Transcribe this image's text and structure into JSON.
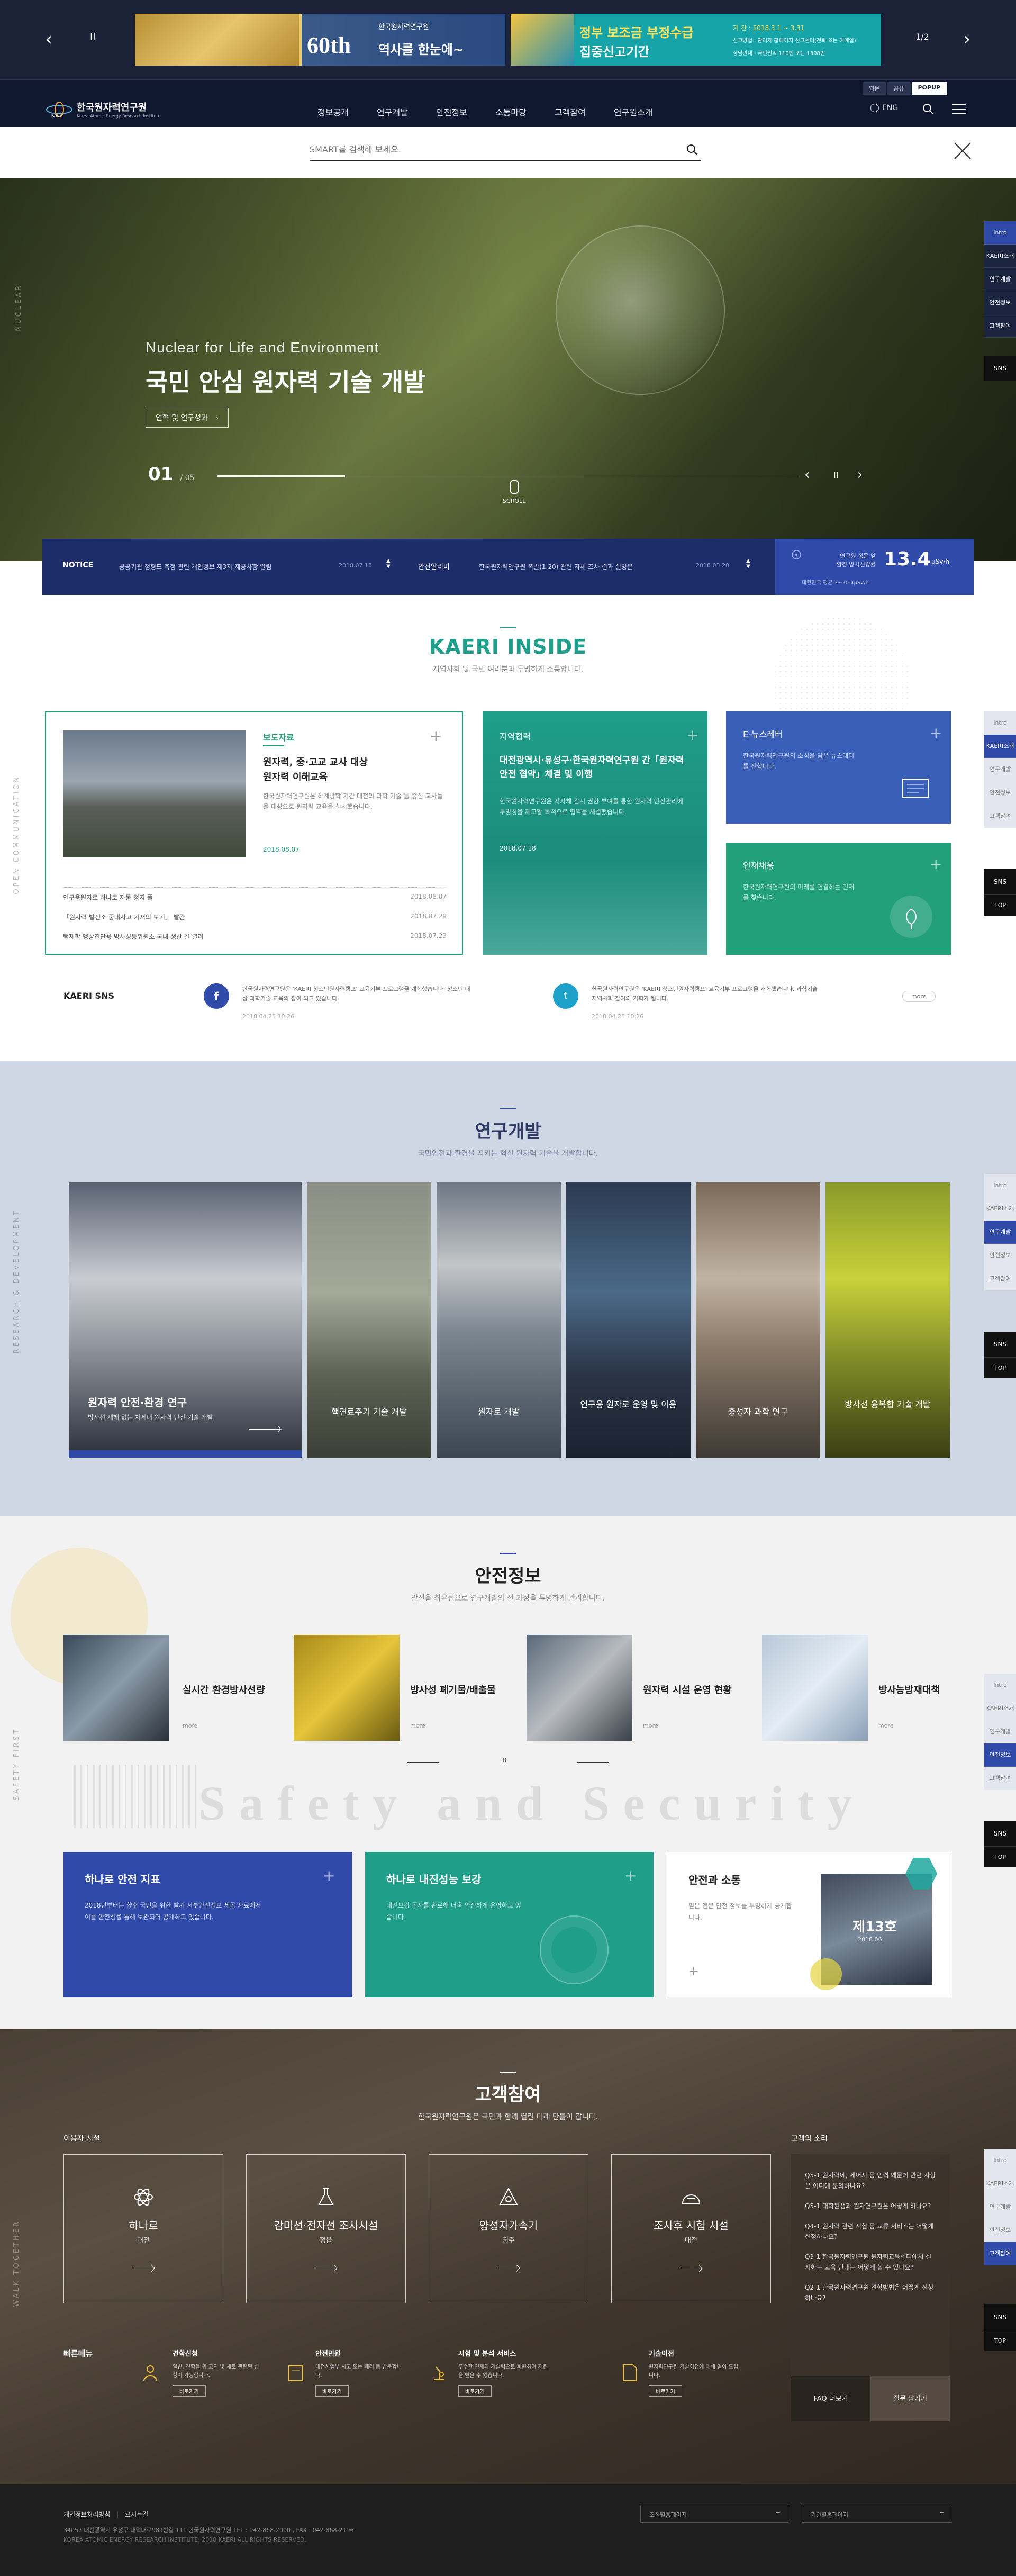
{
  "popup_banner": {
    "popup1": {
      "small": "한국원자력연구원",
      "big": "60th",
      "rest": "역사를 한눈에~"
    },
    "popup2": {
      "line1": "정부 보조금 부정수급",
      "line2": "집중신고기간",
      "detail1": "기 간 : 2018.3.1 ~ 3.31",
      "detail2": "신고방법 : 관리자 홈페이지 신고센터(전화 또는 이메일)",
      "detail3": "상담안내 : 국민권익 110번 또는 1398번"
    },
    "counter": "1/2",
    "pause": "II"
  },
  "utility": {
    "links": [
      "영문",
      "공유",
      "POPUP"
    ]
  },
  "header": {
    "logo_kr": "한국원자력연구원",
    "logo_en": "Korea Atomic Energy Research Institute",
    "logo_mark": "KAERI",
    "gnb": [
      "정보공개",
      "연구개발",
      "안전정보",
      "소통마당",
      "고객참여",
      "연구원소개"
    ],
    "lang": "ENG"
  },
  "search": {
    "placeholder": "SMART를 검색해 보세요."
  },
  "hero": {
    "subtitle": "Nuclear for Life and Environment",
    "title": "국민 안심 원자력 기술 개발",
    "button": "연혁 및 연구성과",
    "current": "01",
    "total": "05",
    "scroll": "SCROLL",
    "side_label": "NUCLEAR"
  },
  "notice": {
    "label": "NOTICE",
    "item1": "공공기관 정형도 측정 관련 개인정보 제3자 제공사항 알림",
    "date1": "2018.07.18",
    "label2": "안전알리미",
    "item2": "한국원자력연구원 폭발(1.20) 관련 자체 조사 결과 설명문",
    "date2": "2018.03.20",
    "rad_label1": "연구원 정문 앞",
    "rad_label2": "환경 방사선량률",
    "rad_value": "13.4",
    "rad_unit": "μSv/h",
    "rad_note": "대한민국 평균 3~30.4μSv/h"
  },
  "inside": {
    "title": "KAERI INSIDE",
    "subtitle": "지역사회 및 국민 여러분과 투명하게 소통합니다.",
    "press": {
      "tag": "보도자료",
      "headline1": "원자력, 중·고교 교사 대상",
      "headline2": "원자력 이해교육",
      "desc": "한국원자력연구원은 하계방학 기간 대전의 과학 기술 틀 중심 교사들을 대상으로 원자력 교육을 실시했습니다.",
      "date": "2018.08.07",
      "list": [
        {
          "title": "연구용원자로 하나로 자동 정지 풀",
          "date": "2018.08.07"
        },
        {
          "title": "「원자력 발전소 중대사고 기저의 보기」 발간",
          "date": "2018.07.29"
        },
        {
          "title": "택제학 앵상진단용 방사성동위원소 국내 생산 길 열려",
          "date": "2018.07.23"
        }
      ]
    },
    "region": {
      "tag": "지역협력",
      "headline": "대전광역시·유성구·한국원자력연구원 간「원자력 안전 협약」체결 및 이행",
      "desc": "한국원자력연구원은 지자체 감시 권한 부여를 통한 원자력 안전관리에 투명성을 제고할 목적으로 협약을 체결했습니다.",
      "date": "2018.07.18"
    },
    "enews": {
      "tag": "E-뉴스레터",
      "desc": "한국원자력연구원의 소식을 담은 뉴스레터를 전합니다."
    },
    "recruit": {
      "tag": "인재채용",
      "desc": "한국원자력연구원의 미래를 연결하는 인재를 찾습니다."
    },
    "sns_label": "KAERI SNS",
    "sns1_text": "한국원자력연구원은 'KAERI 청소년원자력캠프' 교육기부 프로그램을 개최했습니다. 청소년 대상 과학기술 교육의 장이 되고 있습니다.",
    "sns1_date": "2018.04.25 10:26",
    "sns2_text": "한국원자력연구원은 'KAERI 청소년원자력캠프' 교육기부 프로그램을 개최했습니다. 과학기술 지역사회 참여의 기회가 됩니다.",
    "sns2_date": "2018.04.25 10:26",
    "more": "more",
    "side_label": "OPEN COMMUNICATION"
  },
  "research": {
    "title": "연구개발",
    "subtitle": "국민안전과 환경을 지키는 혁신 원자력 기술을 개발합니다.",
    "items": [
      {
        "title": "원자력 안전·환경 연구",
        "desc": "방사선 재해 없는 차세대 원자력 안전 기술 개발"
      },
      {
        "title": "핵연료주기 기술 개발"
      },
      {
        "title": "원자로 개발"
      },
      {
        "title": "연구용 원자로 운영 및 이용"
      },
      {
        "title": "중성자 과학 연구"
      },
      {
        "title": "방사선 융복합 기술 개발"
      }
    ],
    "side_label": "RESEARCH & DEVELOPMENT"
  },
  "safety": {
    "title": "안전정보",
    "subtitle": "안전을 최우선으로 연구개발의 전 과정을 투명하게 관리합니다.",
    "items": [
      {
        "title": "실시간 환경방사선량",
        "more": "more"
      },
      {
        "title": "방사성 폐기물/배출물",
        "more": "more"
      },
      {
        "title": "원자력 시설 운영 현황",
        "more": "more"
      },
      {
        "title": "방사능방재대책",
        "more": "more"
      }
    ],
    "pager": "II",
    "watermark": "Safety and Security",
    "card1": {
      "title": "하나로 안전 지표",
      "desc": "2018년부터는 향후 국민을 위한 발기 서부안전정보 제공 자료에서 이를 안전성을 통해 보완되어 공개하고 있습니다."
    },
    "card2": {
      "title": "하나로 내진성능 보강",
      "desc": "내진보강 공사를 완료해 더욱 안전하게 운영하고 있습니다."
    },
    "card3": {
      "title": "안전과 소통",
      "desc": "믿은 전문 안전 정보를 투명하게 공개합니다.",
      "vol": "제13호",
      "vol_sub": "2018.06"
    },
    "side_label": "SAFETY FIRST"
  },
  "customer": {
    "title": "고객참여",
    "subtitle": "한국원자력연구원은 국민과 함께 열린 미래 만들어 갑니다.",
    "facility_label": "이용자 시설",
    "facilities": [
      {
        "title": "하나로",
        "sub": "대전"
      },
      {
        "title": "감마선·전자선 조사시설",
        "sub": "정읍"
      },
      {
        "title": "양성자가속기",
        "sub": "경주"
      },
      {
        "title": "조사후 시험 시설",
        "sub": "대전"
      }
    ],
    "quick_label": "빠른메뉴",
    "services": [
      {
        "title": "견학신청",
        "desc": "일반, 견학을 위 고지 빛 새로 관련된 신청이 가능합니다.",
        "btn": "바로가기"
      },
      {
        "title": "안전민원",
        "desc": "대전사업부 사고 또는 폐리 등 방문합니다.",
        "btn": "바로가기"
      },
      {
        "title": "시험 및 분석 서비스",
        "desc": "우수한 인재와 기술력으로 회원하여 지원을 받을 수 있습니다.",
        "btn": "바로가기"
      },
      {
        "title": "기술이전",
        "desc": "원자력연구원 기술이전에 대해 알아 드립니다.",
        "btn": "바로가기"
      }
    ],
    "voice_label": "고객의 소리",
    "faq": [
      "Q5-1 원자력에, 세어지 등 인력 왜문에 관련 사항은 어디에 문의하나요?",
      "Q5-1 대학원생과 원자연구원은 어떻게 하나요?",
      "Q4-1 원자력 관련 시험 등 교류 서비스는 어떻게 신청하나요?",
      "Q3-1 한국원자력연구원 원자력교육센터에서 실시하는 교육 안내는 어떻게 볼 수 있나요?",
      "Q2-1 한국원자력연구원 견학방법은 어떻게 신청하나요?"
    ],
    "faq_btn": "FAQ 더보기",
    "ask_btn": "질문 남기기",
    "side_label": "WALK TOGETHER"
  },
  "footer": {
    "links": [
      "개인정보처리방침",
      "오시는길"
    ],
    "address": "34057 대전광역시 유성구 대덕대로989번길 111 한국원자력연구원 TEL : 042-868-2000 , FAX : 042-868-2196",
    "copyright": "KOREA ATOMIC ENERGY RESEARCH INSTITUTE, 2018 KAERI ALL RIGHTS RESERVED.",
    "select1": "조직별홈페이지",
    "select2": "기관별홈페이지"
  },
  "sidebar_hero": [
    "Intro",
    "KAERI소개",
    "연구개발",
    "안전정보",
    "고객참여"
  ],
  "sidebar_inside": [
    "Intro",
    "KAERI소개",
    "연구개발",
    "안전정보",
    "고객참여"
  ],
  "sidebar_research": [
    "Intro",
    "KAERI소개",
    "연구개발",
    "안전정보",
    "고객참여"
  ],
  "sidebar_safety": [
    "Intro",
    "KAERI소개",
    "연구개발",
    "안전정보",
    "고객참여"
  ],
  "sidebar_customer": [
    "Intro",
    "KAERI소개",
    "연구개발",
    "안전정보",
    "고객참여"
  ],
  "sns_btn": "SNS",
  "top_btn": "TOP",
  "colors": {
    "navy": "#1c2338",
    "blue": "#2f4aa8",
    "teal": "#1f9e8a",
    "green": "#22a07a"
  }
}
